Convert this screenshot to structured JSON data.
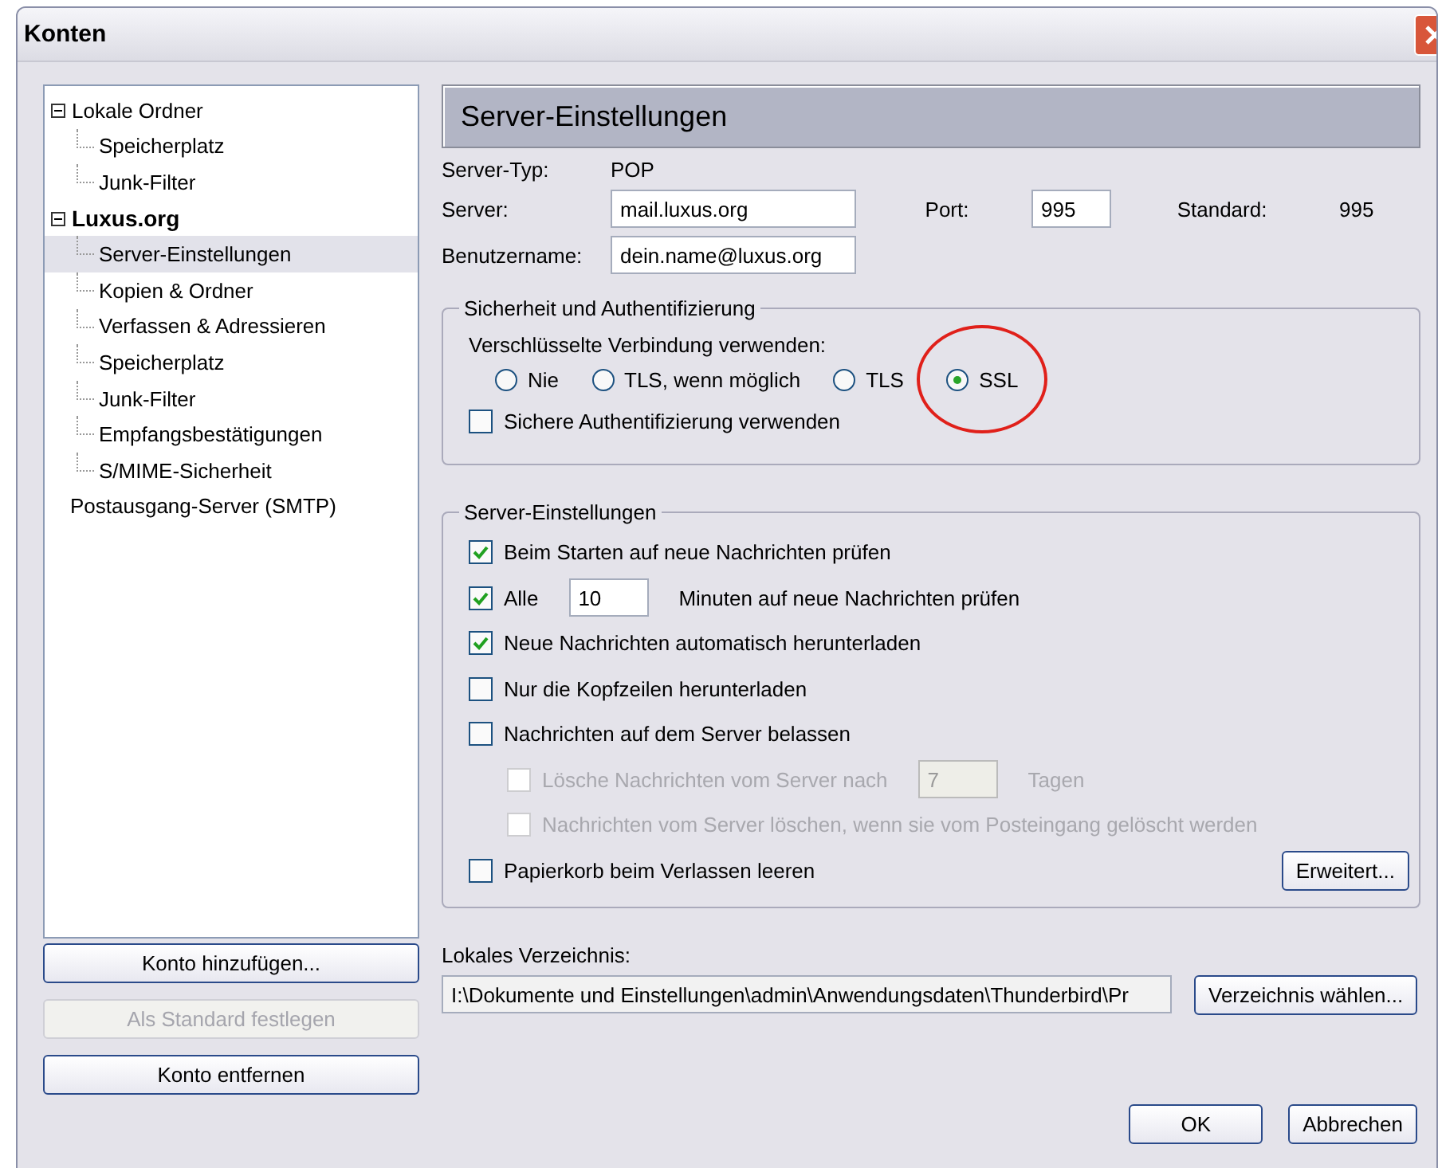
{
  "window": {
    "title": "Konten"
  },
  "tree": [
    {
      "label": "Lokale Ordner",
      "emphasized": false,
      "selected": false,
      "expanded": true,
      "children": [
        {
          "label": "Speicherplatz",
          "selected": false
        },
        {
          "label": "Junk-Filter",
          "selected": false
        }
      ]
    },
    {
      "label": "Luxus.org",
      "emphasized": true,
      "selected": false,
      "expanded": true,
      "children": [
        {
          "label": "Server-Einstellungen",
          "selected": true
        },
        {
          "label": "Kopien & Ordner",
          "selected": false
        },
        {
          "label": "Verfassen & Adressieren",
          "selected": false
        },
        {
          "label": "Speicherplatz",
          "selected": false
        },
        {
          "label": "Junk-Filter",
          "selected": false
        },
        {
          "label": "Empfangsbestätigungen",
          "selected": false
        },
        {
          "label": "S/MIME-Sicherheit",
          "selected": false
        }
      ]
    },
    {
      "label": "Postausgang-Server (SMTP)",
      "emphasized": false,
      "selected": false
    }
  ],
  "account_buttons": [
    {
      "label": "Konto hinzufügen...",
      "disabled": false
    },
    {
      "label": "Als Standard festlegen",
      "disabled": true
    },
    {
      "label": "Konto entfernen",
      "disabled": false
    }
  ],
  "panel": {
    "heading": "Server-Einstellungen",
    "server_type": {
      "label": "Server-Typ:",
      "value": "POP"
    },
    "server": {
      "label": "Server:",
      "value": "mail.luxus.org"
    },
    "port": {
      "label": "Port:",
      "value": "995"
    },
    "standard": {
      "label": "Standard:",
      "value": "995"
    },
    "username": {
      "label": "Benutzername:",
      "value": "dein.name@luxus.org"
    },
    "security": {
      "title": "Sicherheit und Authentifizierung",
      "prompt": "Verschlüsselte Verbindung verwenden:",
      "options": [
        {
          "label": "Nie",
          "selected": false,
          "highlighted": false
        },
        {
          "label": "TLS, wenn möglich",
          "selected": false,
          "highlighted": false
        },
        {
          "label": "TLS",
          "selected": false,
          "highlighted": false
        },
        {
          "label": "SSL",
          "selected": true,
          "highlighted": true
        }
      ],
      "secure_auth": {
        "label": "Sichere Authentifizierung verwenden",
        "checked": false
      }
    },
    "server_settings": {
      "title": "Server-Einstellungen",
      "options": [
        {
          "label": "Beim Starten auf neue Nachrichten prüfen",
          "checked": true,
          "disabled": false
        },
        {
          "label": "Alle",
          "field": "10",
          "suffix": "Minuten auf neue Nachrichten prüfen",
          "checked": true,
          "disabled": false
        },
        {
          "label": "Neue Nachrichten automatisch herunterladen",
          "checked": true,
          "disabled": false
        },
        {
          "label": "Nur die Kopfzeilen herunterladen",
          "checked": false,
          "disabled": false
        },
        {
          "label": "Nachrichten auf dem Server belassen",
          "checked": false,
          "disabled": false,
          "children": [
            {
              "label": "Lösche Nachrichten vom Server nach",
              "field": "7",
              "suffix": "Tagen",
              "checked": false,
              "disabled": true
            },
            {
              "label": "Nachrichten vom Server löschen, wenn sie vom Posteingang gelöscht werden",
              "checked": false,
              "disabled": true
            }
          ]
        },
        {
          "label": "Papierkorb beim Verlassen leeren",
          "checked": false,
          "disabled": false
        }
      ],
      "advanced_button": "Erweitert..."
    },
    "local_directory": {
      "label": "Lokales Verzeichnis:",
      "value": "I:\\Dokumente und Einstellungen\\admin\\Anwendungsdaten\\Thunderbird\\Pr",
      "button": "Verzeichnis wählen..."
    }
  },
  "dialog_buttons": [
    "OK",
    "Abbrechen"
  ]
}
